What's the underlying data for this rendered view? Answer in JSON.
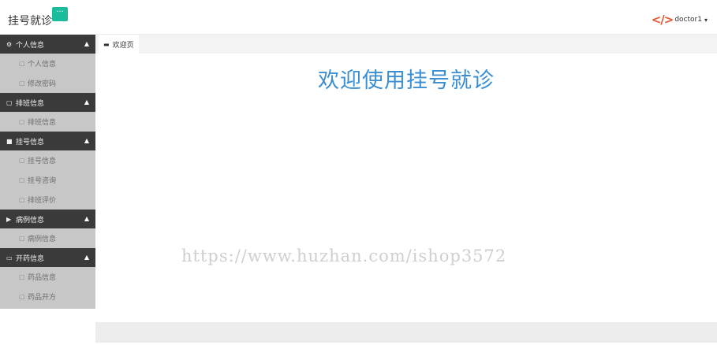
{
  "header": {
    "app_title": "挂号就诊",
    "menu_toggle_label": "···",
    "user_name": "doctor1",
    "caret": "▾"
  },
  "sidebar": {
    "groups": [
      {
        "title": "个人信息",
        "icon": "gear-icon",
        "items": [
          {
            "label": "个人信息"
          },
          {
            "label": "修改密码"
          }
        ]
      },
      {
        "title": "排班信息",
        "icon": "file-icon",
        "items": [
          {
            "label": "排班信息"
          }
        ]
      },
      {
        "title": "挂号信息",
        "icon": "folder-icon",
        "items": [
          {
            "label": "挂号信息"
          },
          {
            "label": "挂号咨询"
          },
          {
            "label": "排班评价"
          }
        ]
      },
      {
        "title": "病例信息",
        "icon": "play-icon",
        "items": [
          {
            "label": "病例信息"
          }
        ]
      },
      {
        "title": "开药信息",
        "icon": "chat-icon",
        "items": [
          {
            "label": "药品信息"
          },
          {
            "label": "药品开方"
          }
        ]
      }
    ]
  },
  "tabs": [
    {
      "label": "欢迎页"
    }
  ],
  "main": {
    "welcome_text": "欢迎使用挂号就诊",
    "watermark": "https://www.huzhan.com/ishop3572"
  },
  "colors": {
    "accent": "#1abc9c",
    "sidebar_header": "#3a3a3a",
    "sidebar_bg": "#c7c7c7",
    "welcome": "#3a8ed1",
    "logo": "#e8542f"
  }
}
